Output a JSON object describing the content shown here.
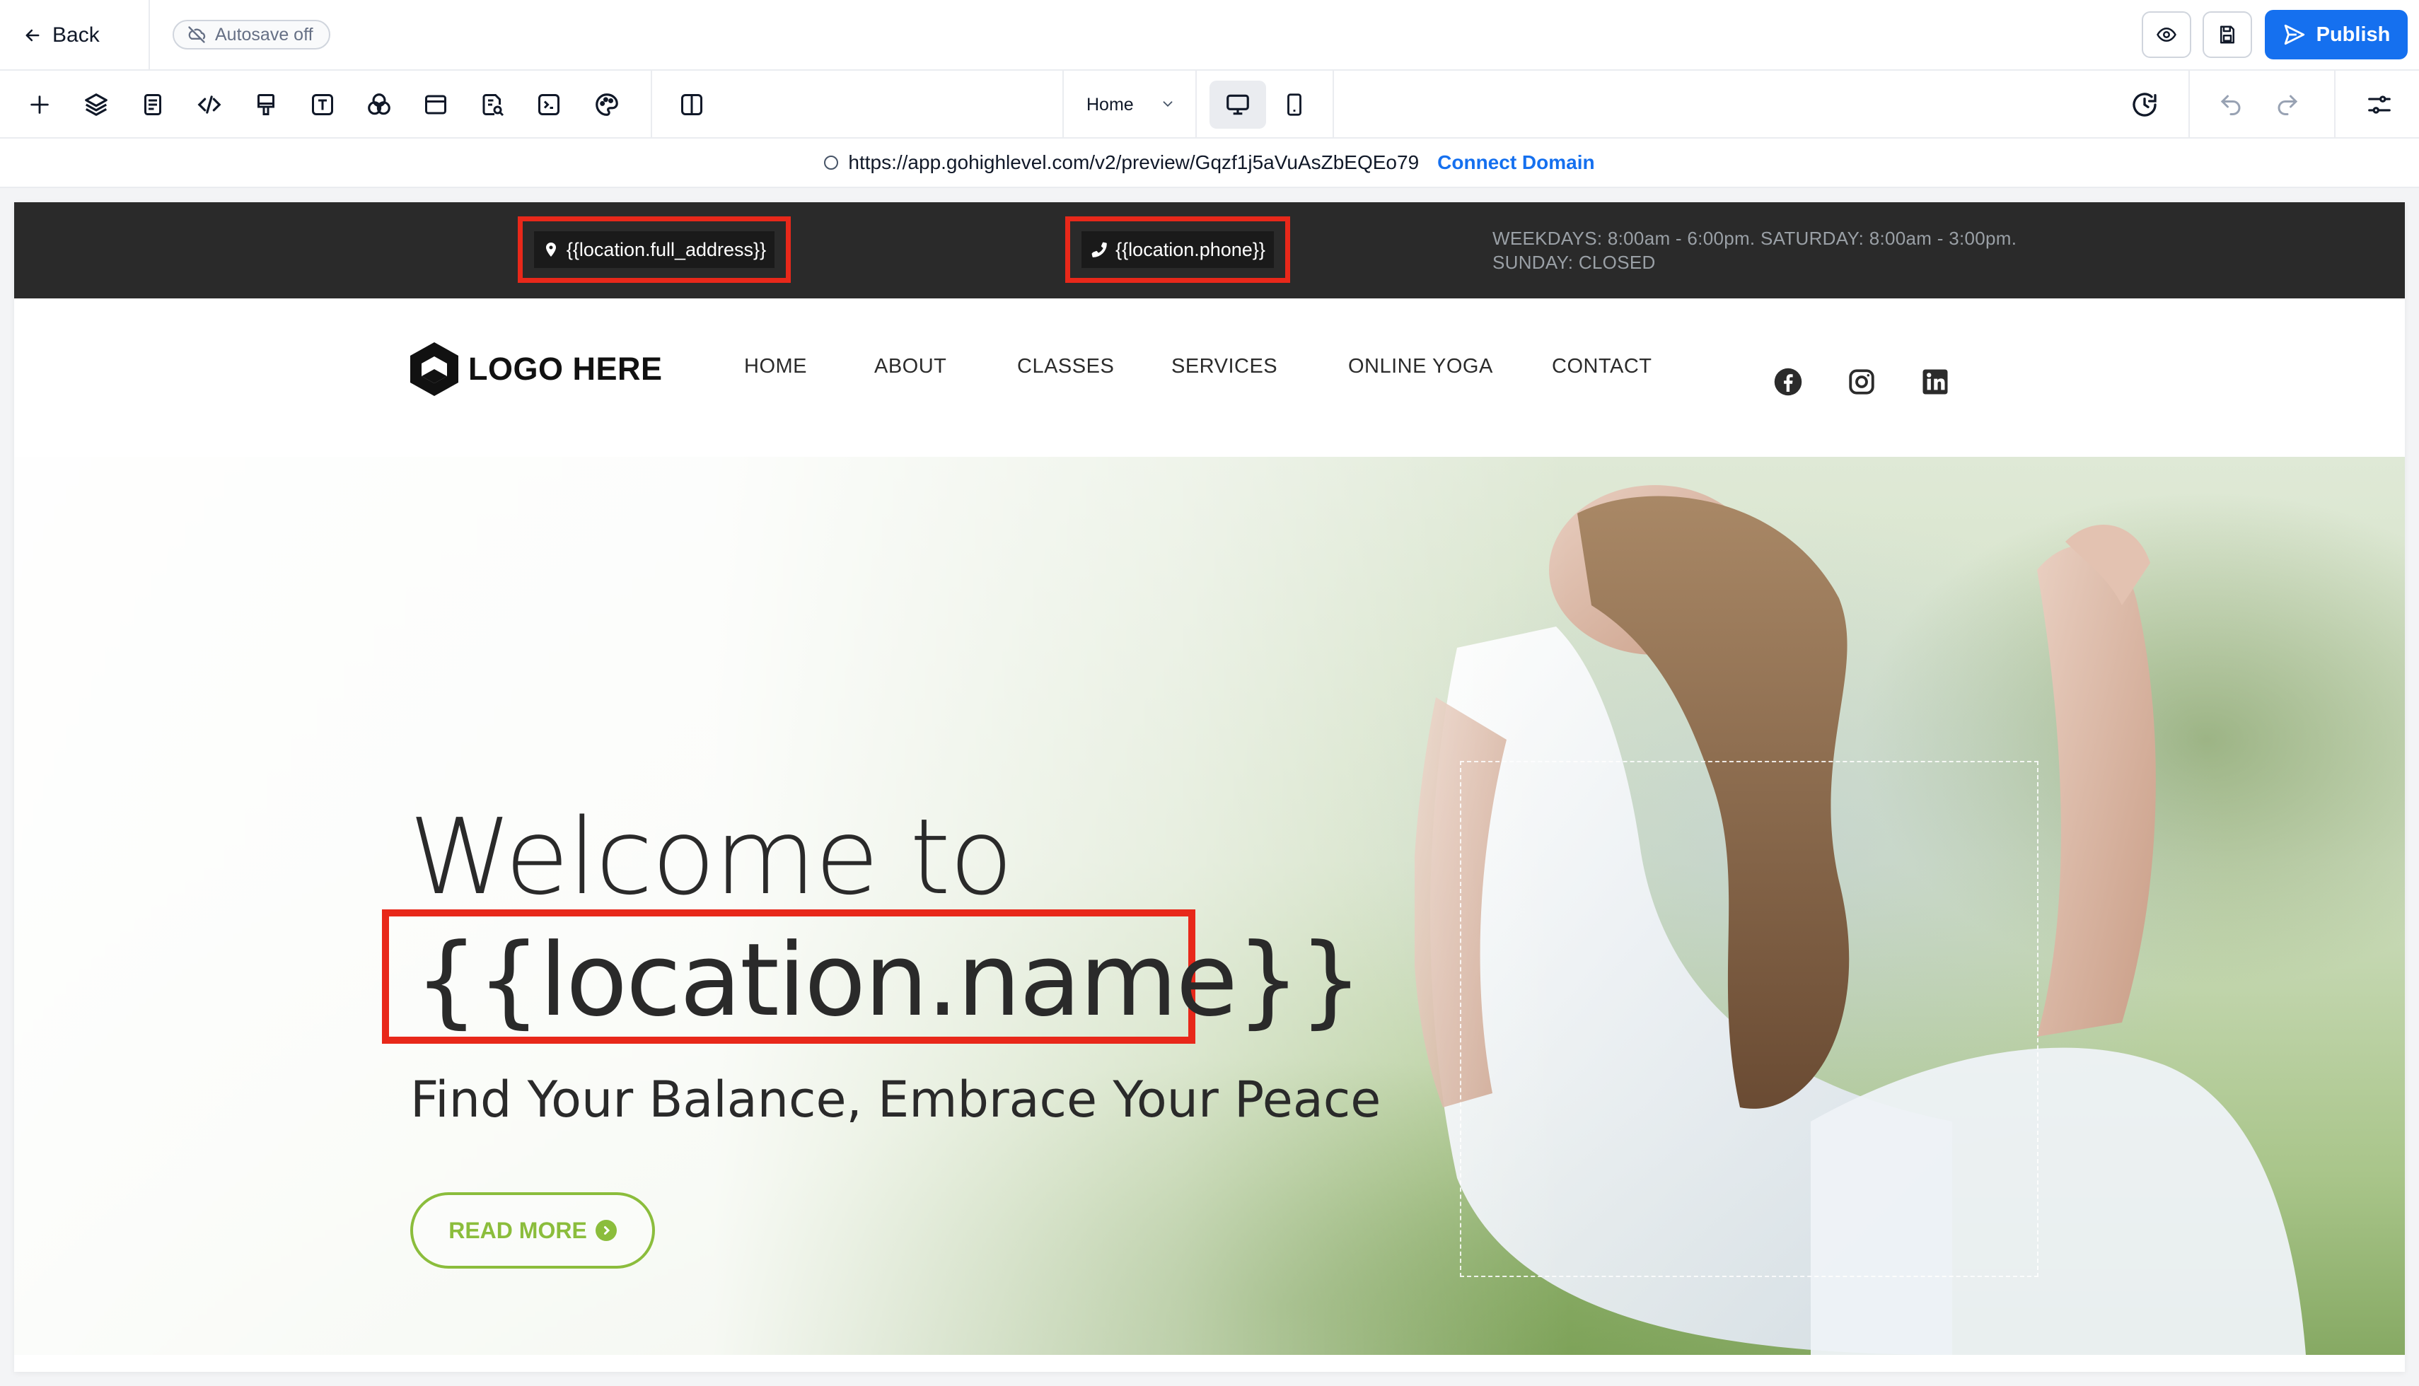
{
  "header": {
    "back_label": "Back",
    "autosave_label": "Autosave off",
    "publish_label": "Publish"
  },
  "toolbar": {
    "tools": [
      "plus-icon",
      "layers-icon",
      "page-icon",
      "code-icon",
      "paint-icon",
      "text-icon",
      "circles-icon",
      "browser-icon",
      "search-doc-icon",
      "terminal-icon",
      "palette-icon",
      "split-view-icon"
    ],
    "page_selector": "Home",
    "active_device": "desktop"
  },
  "urlbar": {
    "url": "https://app.gohighlevel.com/v2/preview/Gqzf1j5aVuAsZbEQEo79",
    "connect_label": "Connect Domain"
  },
  "site": {
    "address": "{{location.full_address}}",
    "phone": "{{location.phone}}",
    "hours_line1": "WEEKDAYS: 8:00am - 6:00pm. SATURDAY: 8:00am - 3:00pm.",
    "hours_line2": "SUNDAY: CLOSED",
    "logo_text": "LOGO HERE",
    "nav": [
      "HOME",
      "ABOUT",
      "CLASSES",
      "SERVICES",
      "ONLINE YOGA",
      "CONTACT"
    ],
    "social": [
      "facebook-icon",
      "instagram-icon",
      "linkedin-icon"
    ],
    "hero": {
      "welcome": "Welcome to",
      "name": "{{location.name}}",
      "tagline": "Find Your Balance, Embrace Your Peace",
      "cta": "READ MORE"
    }
  },
  "colors": {
    "accent": "#1570ef",
    "highlight": "#e8281a",
    "cta": "#8bbd3c",
    "infobar": "#2a2a2a"
  }
}
